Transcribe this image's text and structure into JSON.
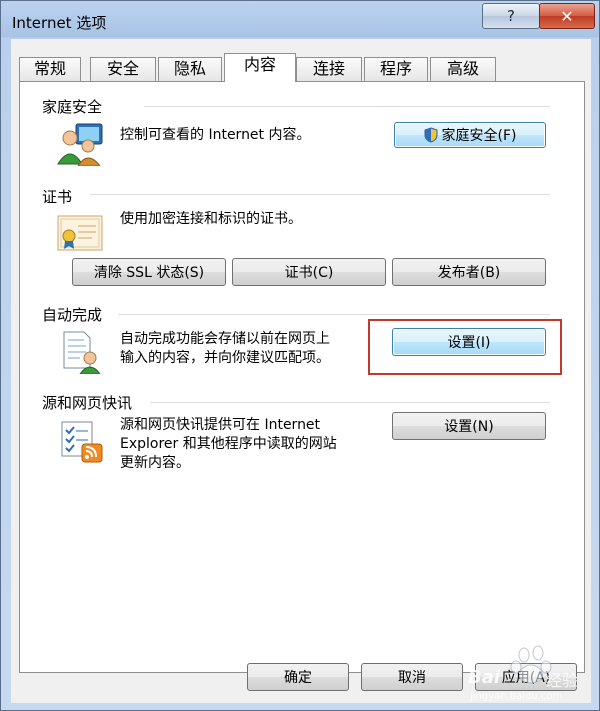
{
  "window": {
    "title": "Internet 选项",
    "help": "?",
    "close": "✕"
  },
  "tabs": [
    {
      "label": "常规",
      "active": false
    },
    {
      "label": "安全",
      "active": false
    },
    {
      "label": "隐私",
      "active": false
    },
    {
      "label": "内容",
      "active": true
    },
    {
      "label": "连接",
      "active": false
    },
    {
      "label": "程序",
      "active": false
    },
    {
      "label": "高级",
      "active": false
    }
  ],
  "family_safety": {
    "title": "家庭安全",
    "desc": "控制可查看的 Internet 内容。",
    "button": "家庭安全(F)",
    "icon": "family-users-icon"
  },
  "certificates": {
    "title": "证书",
    "desc": "使用加密连接和标识的证书。",
    "icon": "certificate-icon",
    "buttons": {
      "clear_ssl": "清除 SSL 状态(S)",
      "certificates": "证书(C)",
      "publishers": "发布者(B)"
    }
  },
  "autocomplete": {
    "title": "自动完成",
    "desc_line1": "自动完成功能会存储以前在网页上",
    "desc_line2": "输入的内容，并向你建议匹配项。",
    "button": "设置(I)",
    "icon": "autocomplete-form-icon"
  },
  "feeds": {
    "title": "源和网页快讯",
    "desc_line1": "源和网页快讯提供可在 Internet",
    "desc_line2": "Explorer 和其他程序中读取的网站",
    "desc_line3": "更新内容。",
    "button": "设置(N)",
    "icon": "rss-feed-icon"
  },
  "footer": {
    "ok": "确定",
    "cancel": "取消",
    "apply": "应用(A)"
  },
  "watermark": {
    "brand": "Bai",
    "brand_cn": "经验",
    "site": "jingyan.baidu.com"
  },
  "colors": {
    "highlight": "#c0392b",
    "focus_button": "#bee6fd",
    "window_frame": "#a9c3e6"
  }
}
